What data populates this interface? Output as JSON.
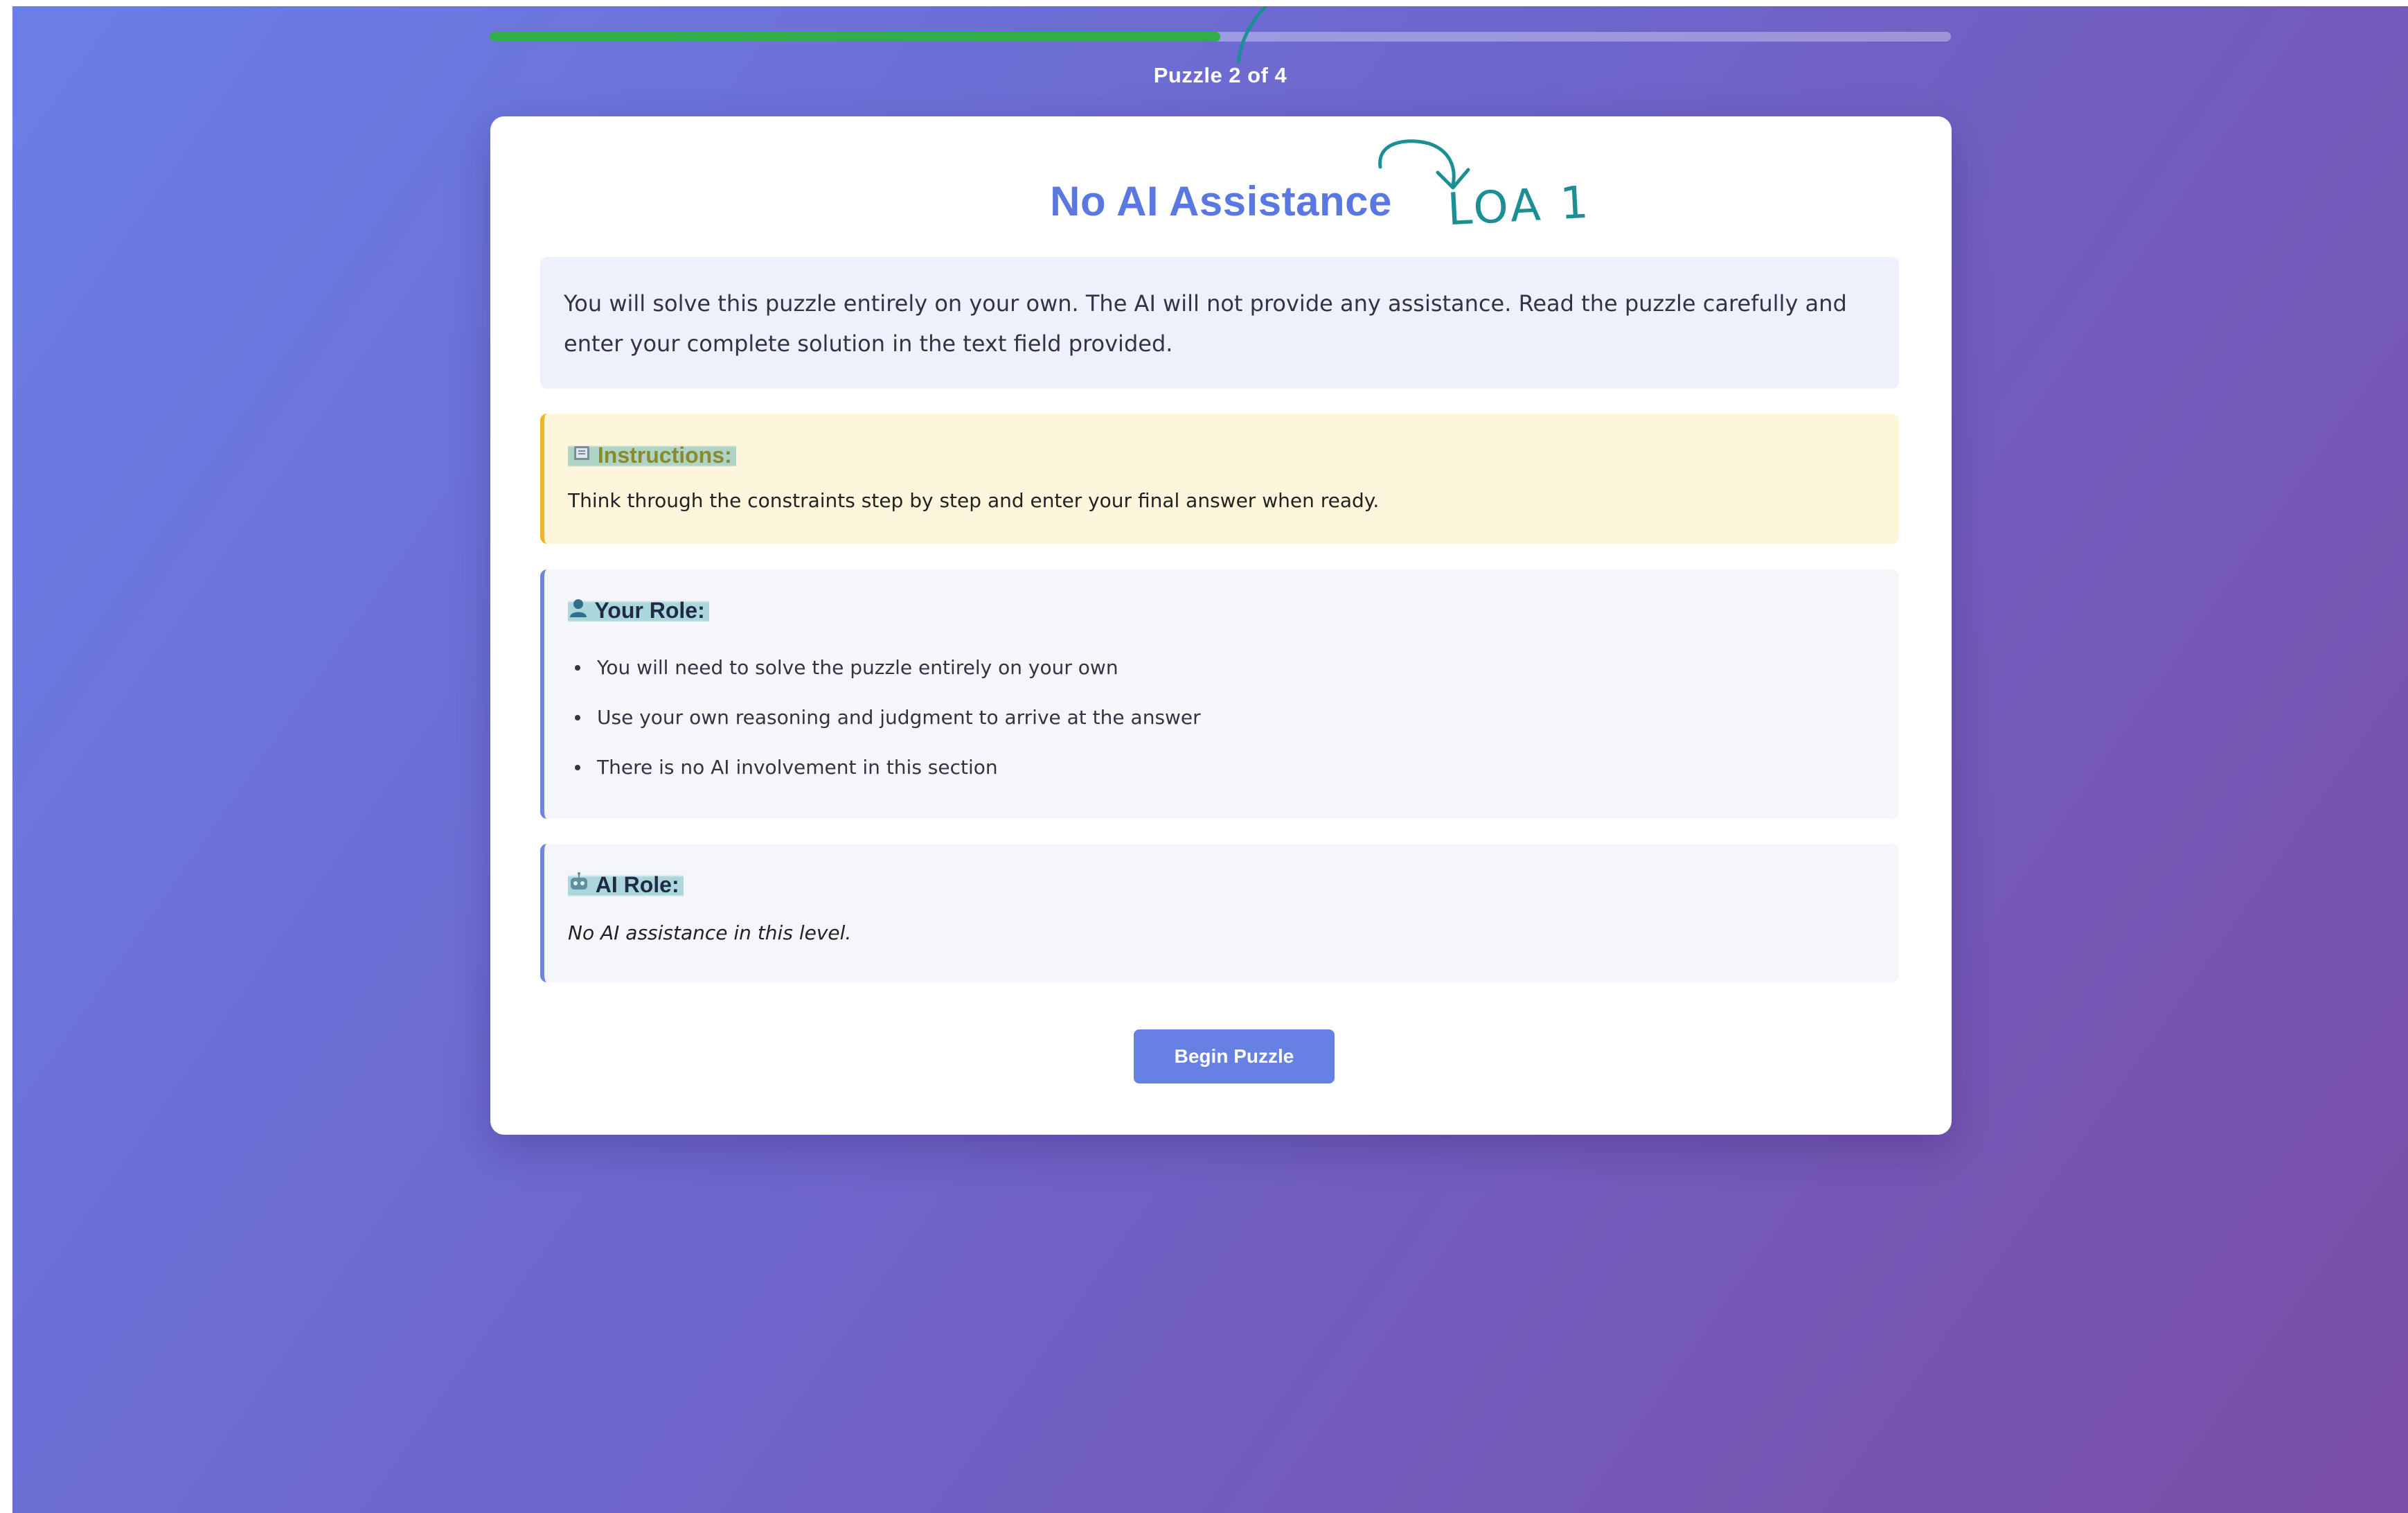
{
  "progress": {
    "label": "Puzzle 2 of 4",
    "fraction": 0.5
  },
  "card": {
    "title": "No AI Assistance",
    "intro": "You will solve this puzzle entirely on your own. The AI will not provide any assistance. Read the puzzle carefully and enter your complete solution in the text field provided.",
    "instructions": {
      "heading": "Instructions:",
      "icon": "book-icon",
      "text": "Think through the constraints step by step and enter your final answer when ready."
    },
    "your_role": {
      "heading": "Your Role:",
      "icon": "person-icon",
      "items": [
        "You will need to solve the puzzle entirely on your own",
        "Use your own reasoning and judgment to arrive at the answer",
        "There is no AI involvement in this section"
      ]
    },
    "ai_role": {
      "heading": "AI Role:",
      "icon": "robot-icon",
      "text": "No AI assistance in this level."
    },
    "begin_button": "Begin Puzzle"
  },
  "annotation": {
    "text": "LOA 1",
    "color": "#1c8f94"
  },
  "colors": {
    "accent": "#5b78e0",
    "progress": "#2fae49",
    "button": "#6680e4",
    "instructions_border": "#f0b429",
    "role_border": "#6f85e0"
  }
}
